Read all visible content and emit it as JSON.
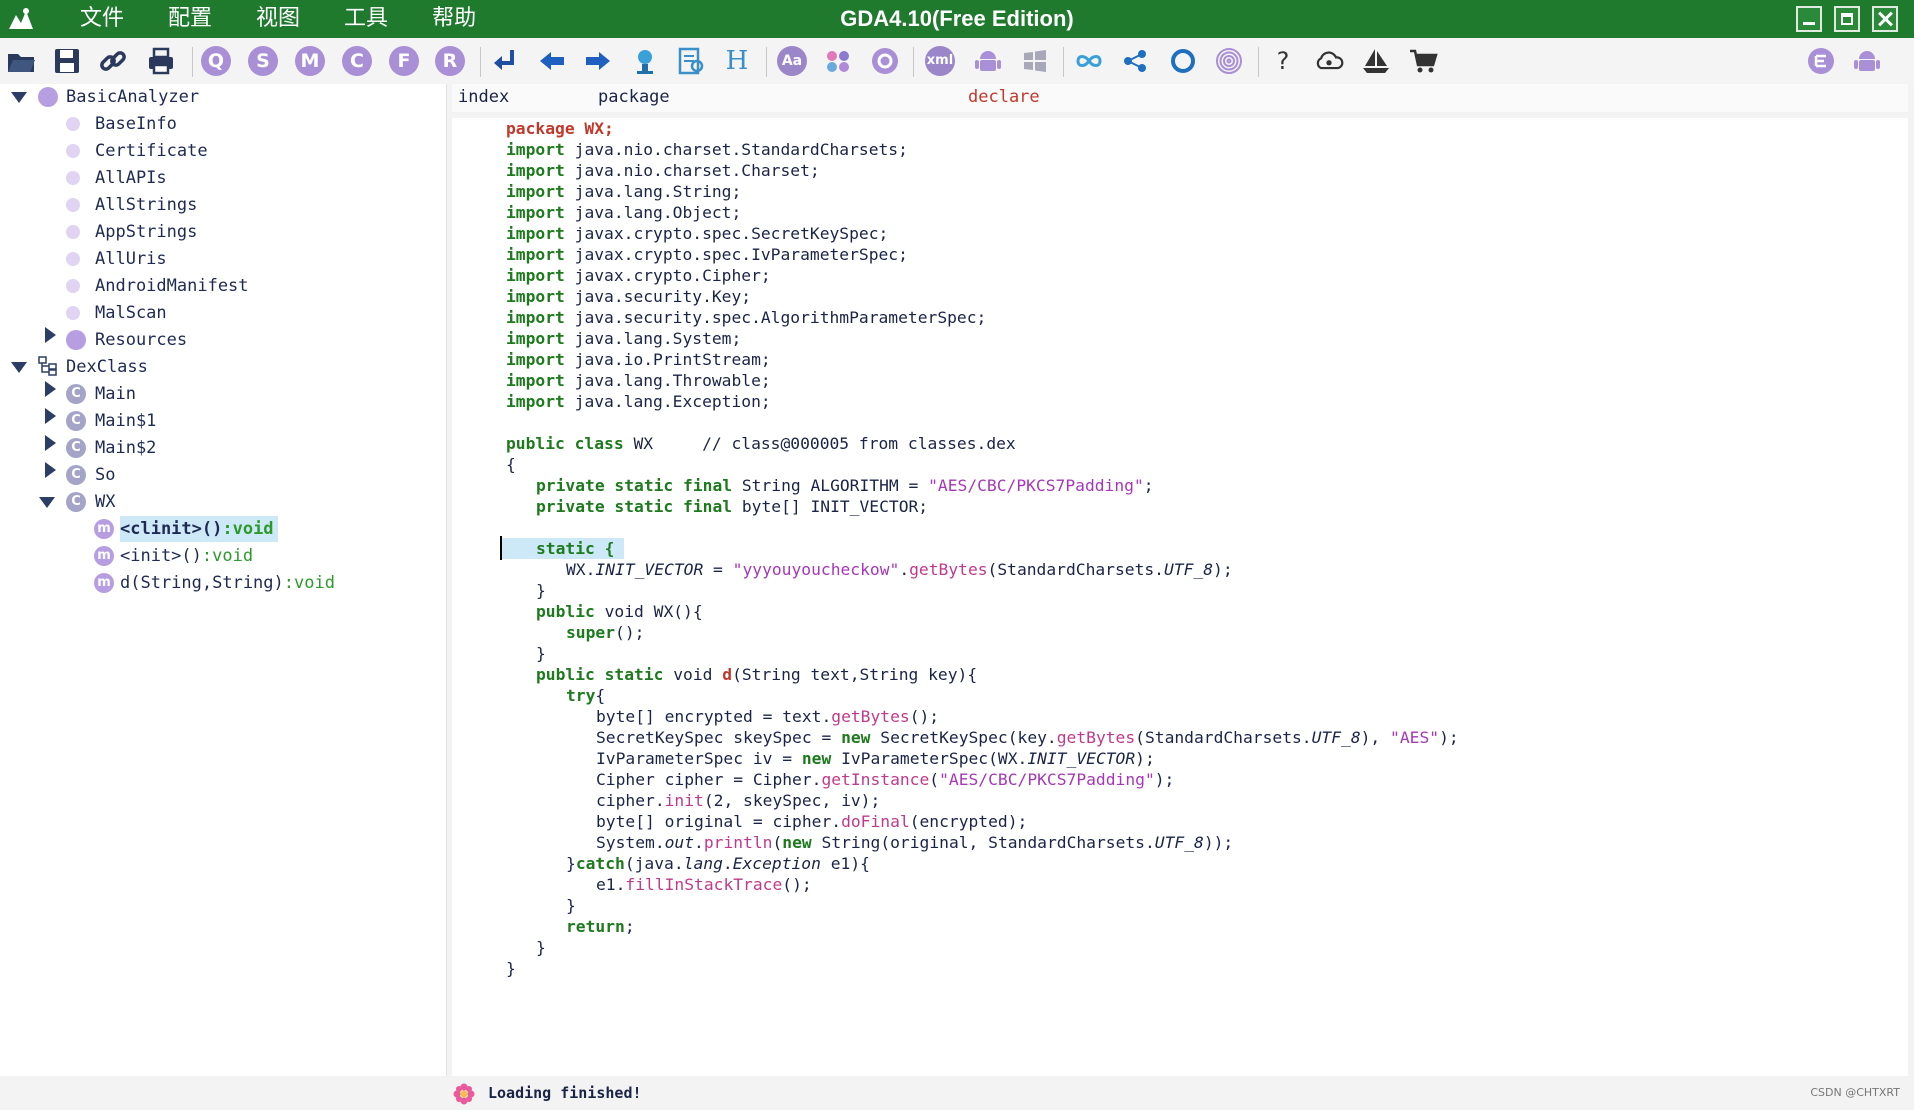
{
  "title_bar": {
    "title": "GDA4.10(Free Edition)",
    "menu": [
      "文件",
      "配置",
      "视图",
      "工具",
      "帮助"
    ]
  },
  "toolbar": {
    "letter_buttons": [
      "Q",
      "S",
      "M",
      "C",
      "F",
      "R"
    ],
    "h_label": "H",
    "aa_label": "Aa",
    "xml_label": "xml",
    "help_label": "?"
  },
  "tree": {
    "basic_analyzer": "BasicAnalyzer",
    "basic_items": [
      "BaseInfo",
      "Certificate",
      "AllAPIs",
      "AllStrings",
      "AppStrings",
      "AllUris",
      "AndroidManifest",
      "MalScan"
    ],
    "resources": "Resources",
    "dexclass": "DexClass",
    "classes": [
      "Main",
      "Main$1",
      "Main$2",
      "So",
      "WX"
    ],
    "class_icon_letter": "C",
    "method_icon_letter": "m",
    "methods": [
      {
        "name": "<clinit>()",
        "ret": ":void"
      },
      {
        "name": "<init>()",
        "ret": ":void"
      },
      {
        "name": "d(String,String)",
        "ret": ":void"
      }
    ]
  },
  "columns": {
    "index": "index",
    "package": "package",
    "declare": "declare"
  },
  "code": {
    "package_line": "package WX;",
    "imports": [
      "java.nio.charset.StandardCharsets;",
      "java.nio.charset.Charset;",
      "java.lang.String;",
      "java.lang.Object;",
      "javax.crypto.spec.SecretKeySpec;",
      "javax.crypto.spec.IvParameterSpec;",
      "javax.crypto.Cipher;",
      "java.security.Key;",
      "java.security.spec.AlgorithmParameterSpec;",
      "java.lang.System;",
      "java.io.PrintStream;",
      "java.lang.Throwable;",
      "java.lang.Exception;"
    ],
    "import_kw": "import"
  },
  "status": {
    "text": "Loading finished!",
    "watermark": "CSDN @CHTXRT"
  }
}
